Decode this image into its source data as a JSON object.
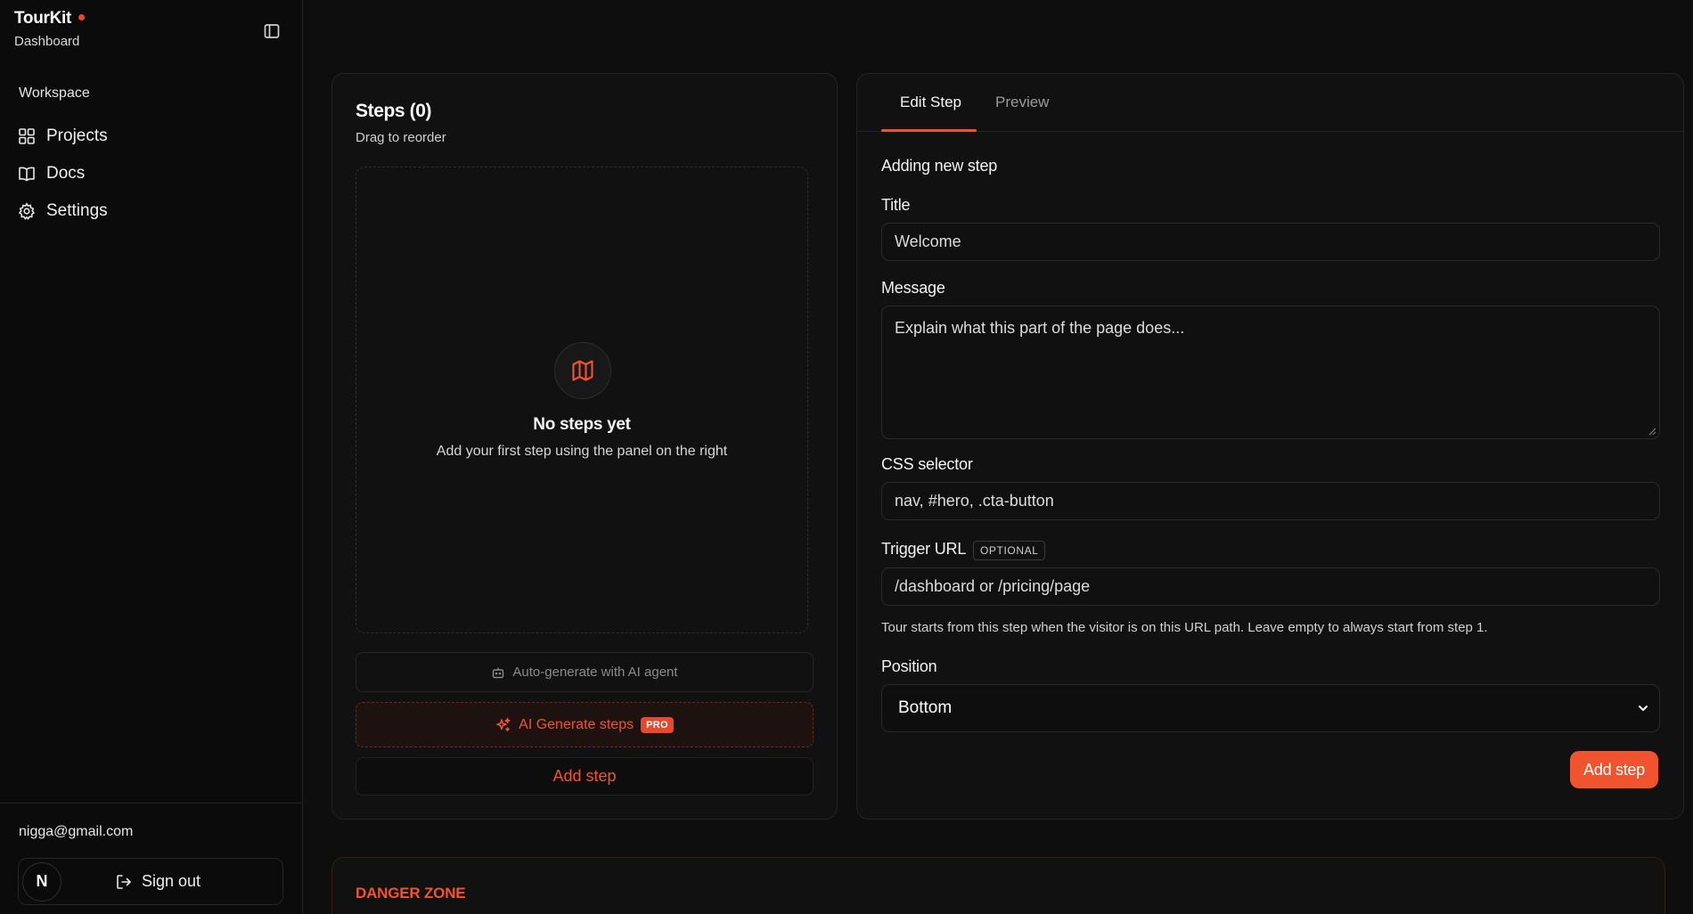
{
  "app": {
    "name": "TourKit",
    "subtitle": "Dashboard"
  },
  "sidebar": {
    "section_label": "Workspace",
    "items": [
      {
        "label": "Projects",
        "icon": "grid-icon"
      },
      {
        "label": "Docs",
        "icon": "book-icon"
      },
      {
        "label": "Settings",
        "icon": "gear-icon"
      }
    ],
    "user": {
      "email": "nigga@gmail.com",
      "avatar_letter": "N",
      "signout_label": "Sign out"
    }
  },
  "steps_panel": {
    "title": "Steps (0)",
    "subtitle": "Drag to reorder",
    "empty_title": "No steps yet",
    "empty_subtitle": "Add your first step using the panel on the right",
    "autogen_label": "Auto-generate with AI agent",
    "ai_generate_label": "AI Generate steps",
    "pro_badge": "PRO",
    "add_step_label": "Add step"
  },
  "editor": {
    "tabs": [
      {
        "label": "Edit Step",
        "active": true
      },
      {
        "label": "Preview",
        "active": false
      }
    ],
    "heading": "Adding new step",
    "title_label": "Title",
    "title_placeholder": "Welcome",
    "message_label": "Message",
    "message_placeholder": "Explain what this part of the page does...",
    "selector_label": "CSS selector",
    "selector_placeholder": "nav, #hero, .cta-button",
    "trigger_label": "Trigger URL",
    "optional_badge": "OPTIONAL",
    "trigger_placeholder": "/dashboard or /pricing/page",
    "trigger_helper": "Tour starts from this step when the visitor is on this URL path. Leave empty to always start from step 1.",
    "position_label": "Position",
    "position_value": "Bottom",
    "submit_label": "Add step"
  },
  "danger_zone": {
    "title": "DANGER ZONE"
  },
  "colors": {
    "accent": "#f0542f",
    "background": "#0e0e0e",
    "card": "#111111"
  }
}
